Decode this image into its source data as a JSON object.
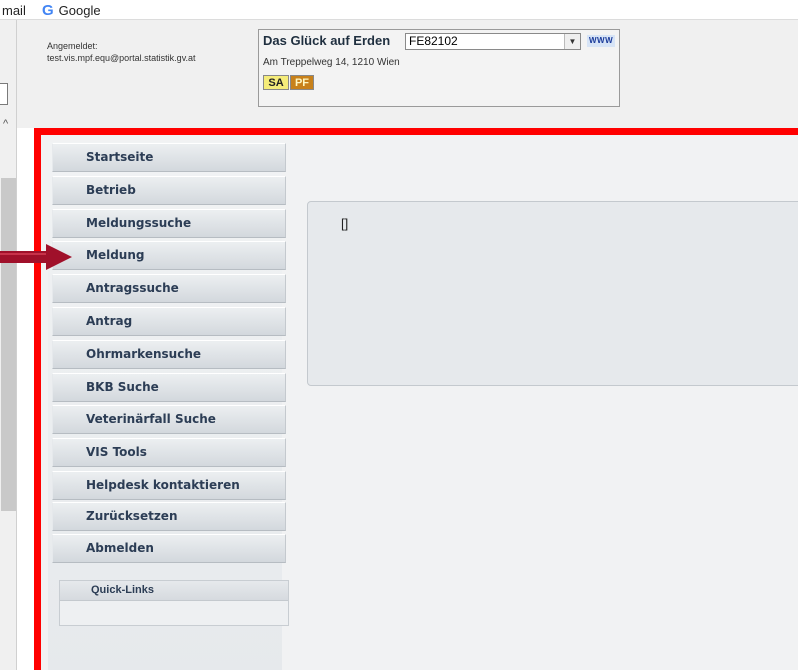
{
  "bookmarks": {
    "mail": "mail",
    "google_icon": "G",
    "google": "Google"
  },
  "header": {
    "login_label": "Angemeldet:",
    "login_user": "test.vis.mpf.equ@portal.statistik.gv.at",
    "business_name": "Das Glück auf Erden",
    "business_id": "FE82102",
    "www_label": "WWW",
    "address": "Am Treppelweg 14, 1210 Wien",
    "badges": [
      "SA",
      "PF"
    ]
  },
  "nav": {
    "items": [
      "Startseite",
      "Betrieb",
      "Meldungssuche",
      "Meldung",
      "Antragssuche",
      "Antrag",
      "Ohrmarkensuche",
      "BKB Suche",
      "Veterinärfall Suche",
      "VIS Tools",
      "Helpdesk kontaktieren",
      "Zurücksetzen",
      "Abmelden"
    ],
    "quicklinks_label": "Quick-Links"
  },
  "content": {
    "placeholder": "[]"
  },
  "colors": {
    "frame": "#ff0000",
    "arrow": "#a0102a",
    "nav_text": "#2c3d55"
  },
  "icons": [
    "google-icon",
    "chevron-down-icon",
    "chevron-up-icon",
    "pointer-arrow-icon"
  ]
}
